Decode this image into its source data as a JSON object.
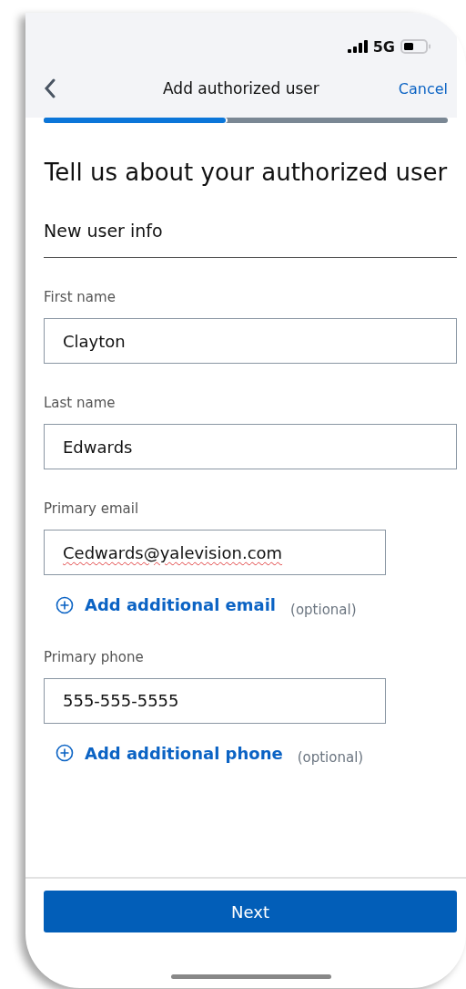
{
  "status_bar": {
    "network": "5G"
  },
  "header": {
    "title": "Add authorized user",
    "cancel": "Cancel"
  },
  "progress": {
    "level": 0.45
  },
  "heading": "Tell us about your authorized user",
  "section_title": "New user info",
  "fields": [
    {
      "label": "First name",
      "value": "Clayton",
      "kind": "text",
      "misspelled": false
    },
    {
      "label": "Last name",
      "value": "Edwards",
      "kind": "text",
      "misspelled": false
    },
    {
      "label": "Primary email",
      "value": "Cedwards@yalevision.com",
      "kind": "email",
      "misspelled": true,
      "add_link": "Add additional email",
      "add_note": "(optional)"
    },
    {
      "label": "Primary phone",
      "value": "555-555-5555",
      "kind": "phone",
      "misspelled": false,
      "add_link": "Add additional phone",
      "add_note": "(optional)"
    }
  ],
  "next_button": "Next"
}
